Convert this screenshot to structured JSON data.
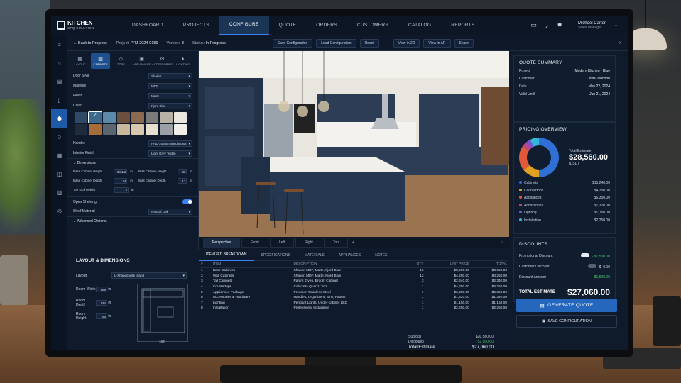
{
  "app": {
    "logo_title": "KITCHEN",
    "logo_sub": "CPQ SOLUTION"
  },
  "nav": {
    "items": [
      "DASHBOARD",
      "PROJECTS",
      "CONFIGURE",
      "QUOTE",
      "ORDERS",
      "CUSTOMERS",
      "CATALOG",
      "REPORTS"
    ],
    "active": 2
  },
  "user": {
    "name": "Michael Carter",
    "role": "Sales Manager"
  },
  "subbar": {
    "back": "Back to Projects",
    "project_label": "Project:",
    "project": "PRJ-2024-0156",
    "version_label": "Version:",
    "version": "3",
    "status_label": "Status:",
    "status": "In Progress",
    "save": "Save Configuration",
    "load": "Load Configuration",
    "reset": "Reset",
    "view2d": "View in 2D",
    "viewar": "View in AR",
    "share": "Share"
  },
  "cfg": {
    "tabs": [
      "LAYOUT",
      "CABINETS",
      "TOPS",
      "APPLIANCES",
      "ACCESSORIES",
      "LIGHTING"
    ],
    "door_style_label": "Door Style",
    "door_style": "Shaker",
    "material_label": "Material",
    "material": "MDF",
    "finish_label": "Finish",
    "finish": "Matte",
    "color_label": "Color",
    "color": "Fjord Blue",
    "swatch_colors": [
      "#2f4a66",
      "#3d6a8c",
      "#5d8aa8",
      "#6b5040",
      "#8a6a50",
      "#7a7a78",
      "#b8b2a6",
      "#e9e6df",
      "#1e2c3e",
      "#a66c3a",
      "#5b6670",
      "#c9b79c",
      "#d8c8ae",
      "#e8dfcf",
      "#9aa0a6",
      "#f2efe8"
    ],
    "handle_label": "Handle",
    "handle": "HND-205 Brushed Brass",
    "interior_label": "Interior Finish",
    "interior": "Light Grey Textile",
    "dimensions_label": "Dimensions",
    "base_h_label": "Base Cabinet Height",
    "base_h": "34 1/2",
    "wall_h_label": "Wall Cabinet Height",
    "wall_h": "30",
    "base_d_label": "Base Cabinet Depth",
    "base_d": "24",
    "wall_d_label": "Wall Cabinet Depth",
    "wall_d": "12",
    "toe_label": "Toe Kick Height",
    "toe": "4",
    "unit": "in",
    "open_shelving_label": "Open Shelving",
    "shelf_material_label": "Shelf Material",
    "shelf_material": "Natural Oak",
    "advanced_label": "Advanced Options"
  },
  "viewport": {
    "tabs": [
      "Perspective",
      "Front",
      "Left",
      "Right",
      "Top"
    ],
    "add": "+"
  },
  "layout_panel": {
    "title": "LAYOUT & DIMENSIONS",
    "layout_label": "Layout",
    "layout": "L-Shaped with Island",
    "width_label": "Room Width",
    "width": "168",
    "depth_label": "Room Depth",
    "depth": "144",
    "height_label": "Room Height",
    "height": "96",
    "unit": "in",
    "plan_dim": "168\""
  },
  "breakdown": {
    "tabs": [
      "ITEMIZED BREAKDOWN",
      "SPECIFICATIONS",
      "MATERIALS",
      "APPLIANCES",
      "NOTES"
    ],
    "headers": [
      "#",
      "ITEM",
      "DESCRIPTION",
      "QTY",
      "UNIT PRICE",
      "TOTAL"
    ],
    "rows": [
      [
        "1",
        "Base Cabinets",
        "Shaker, MDF, Matte, Fjord Blue",
        "16",
        "$8,650.00",
        "$8,650.00"
      ],
      [
        "2",
        "Wall Cabinets",
        "Shaker, MDF, Matte, Fjord Blue",
        "12",
        "$4,250.00",
        "$4,250.00"
      ],
      [
        "3",
        "Tall Cabinets",
        "Pantry, Oven, Broom Cabinet",
        "3",
        "$2,340.00",
        "$2,340.00"
      ],
      [
        "4",
        "Countertops",
        "Calacatta Quartz, 3cm",
        "1",
        "$4,250.00",
        "$4,250.00"
      ],
      [
        "5",
        "Appliances Package",
        "Premium Stainless Steel",
        "1",
        "$6,350.00",
        "$6,350.00"
      ],
      [
        "6",
        "Accessories & Hardware",
        "Handles, Organizers, Sink, Faucet",
        "1",
        "$1,320.00",
        "$1,320.00"
      ],
      [
        "7",
        "Lighting",
        "Pendant Lights, Under-cabinet LED",
        "1",
        "$1,150.00",
        "$1,150.00"
      ],
      [
        "8",
        "Installation",
        "Professional Installation",
        "1",
        "$2,250.00",
        "$2,250.00"
      ]
    ],
    "subtotal_label": "Subtotal",
    "subtotal": "$30,560.00",
    "discounts_label": "Discounts",
    "discounts": "- $1,500.00",
    "total_label": "Total Estimate",
    "total": "$27,060.00"
  },
  "quote_summary": {
    "title": "QUOTE SUMMARY",
    "rows": [
      [
        "Project",
        "Modern Kitchen - Blue"
      ],
      [
        "Customer",
        "Olivia Johnson"
      ],
      [
        "Date",
        "May 22, 2024"
      ],
      [
        "Valid Until",
        "Jun 21, 2024"
      ]
    ]
  },
  "pricing": {
    "title": "PRICING OVERVIEW",
    "total_label": "Total Estimate",
    "total": "$28,560.00",
    "currency": "(USD)",
    "items": [
      {
        "name": "Cabinets",
        "value": "$15,240.00",
        "amount": 15240,
        "color": "#2f6fd6"
      },
      {
        "name": "Countertops",
        "value": "$4,250.00",
        "amount": 4250,
        "color": "#e0a020"
      },
      {
        "name": "Appliances",
        "value": "$6,350.00",
        "amount": 6350,
        "color": "#e05a3a"
      },
      {
        "name": "Accessories",
        "value": "$1,320.00",
        "amount": 1320,
        "color": "#b8468f"
      },
      {
        "name": "Lighting",
        "value": "$1,150.00",
        "amount": 1150,
        "color": "#7a54d0"
      },
      {
        "name": "Installation",
        "value": "$2,250.00",
        "amount": 2250,
        "color": "#35b6d8"
      }
    ]
  },
  "discounts": {
    "title": "DISCOUNTS",
    "promo_label": "Promotional Discount",
    "promo": "- $1,500.00",
    "customer_label": "Customer Discount",
    "customer_cur": "$",
    "customer": "0.00",
    "amount_label": "Discount Amount",
    "amount": "- $1,500.00",
    "total_label": "TOTAL ESTIMATE",
    "total": "$27,060.00"
  },
  "actions": {
    "generate": "GENERATE QUOTE",
    "save": "SAVE CONFIGURATION"
  }
}
